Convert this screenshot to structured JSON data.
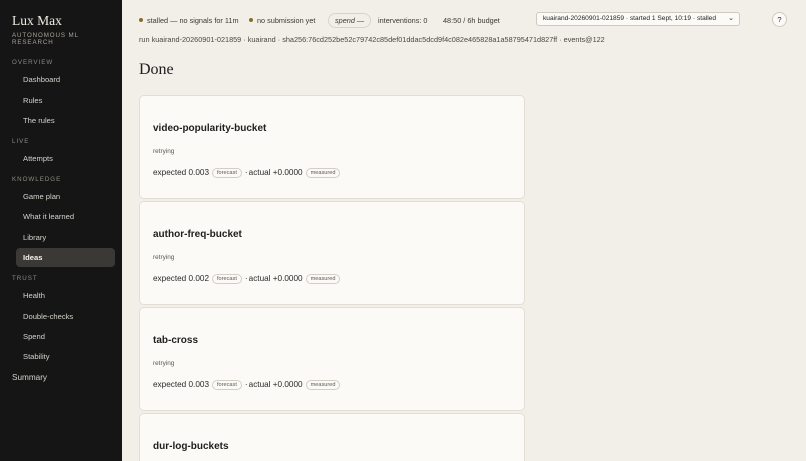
{
  "sidebar": {
    "brand": "Lux Max",
    "brand_sub": "AUTONOMOUS ML RESEARCH",
    "sections": {
      "overview": "OVERVIEW",
      "live": "LIVE",
      "knowledge": "KNOWLEDGE",
      "trust": "TRUST"
    },
    "items": {
      "dashboard": "Dashboard",
      "rules": "Rules",
      "the_rules": "The rules",
      "attempts": "Attempts",
      "game_plan": "Game plan",
      "what_it_learned": "What it learned",
      "library": "Library",
      "ideas": "Ideas",
      "health": "Health",
      "double_checks": "Double-checks",
      "spend": "Spend",
      "stability": "Stability"
    },
    "active_item": "Ideas",
    "summary": "Summary"
  },
  "topbar": {
    "stalled": "stalled — no signals for 11m",
    "submission": "no submission yet",
    "spend": "spend —",
    "interventions": "interventions: 0",
    "budget": "48:50 / 6h budget",
    "run_select": "kuairand-20260901-021859 · started 1 Sept, 10:19 · stalled",
    "help": "?"
  },
  "run_line": "run kuairand-20260901-021859 · kuairand · sha256:76cd252be52c79742c85def01ddac5dcd9f4c082e465828a1a58795471d827ff · events@122",
  "page_title": "Done",
  "labels": {
    "forecast": "forecast",
    "measured": "measured",
    "sep": "·"
  },
  "cards": [
    {
      "name": "video-popularity-bucket",
      "status": "retrying",
      "expected": "expected 0.003",
      "actual": "actual +0.0000"
    },
    {
      "name": "author-freq-bucket",
      "status": "retrying",
      "expected": "expected 0.002",
      "actual": "actual +0.0000"
    },
    {
      "name": "tab-cross",
      "status": "retrying",
      "expected": "expected 0.003",
      "actual": "actual +0.0000"
    },
    {
      "name": "dur-log-buckets",
      "status": "",
      "expected": "",
      "actual": ""
    }
  ],
  "colors": {
    "sidebar_bg": "#151515",
    "main_bg": "#f2efe9",
    "card_bg": "#fbfaf6",
    "status_dot": "#8a6d2e"
  }
}
